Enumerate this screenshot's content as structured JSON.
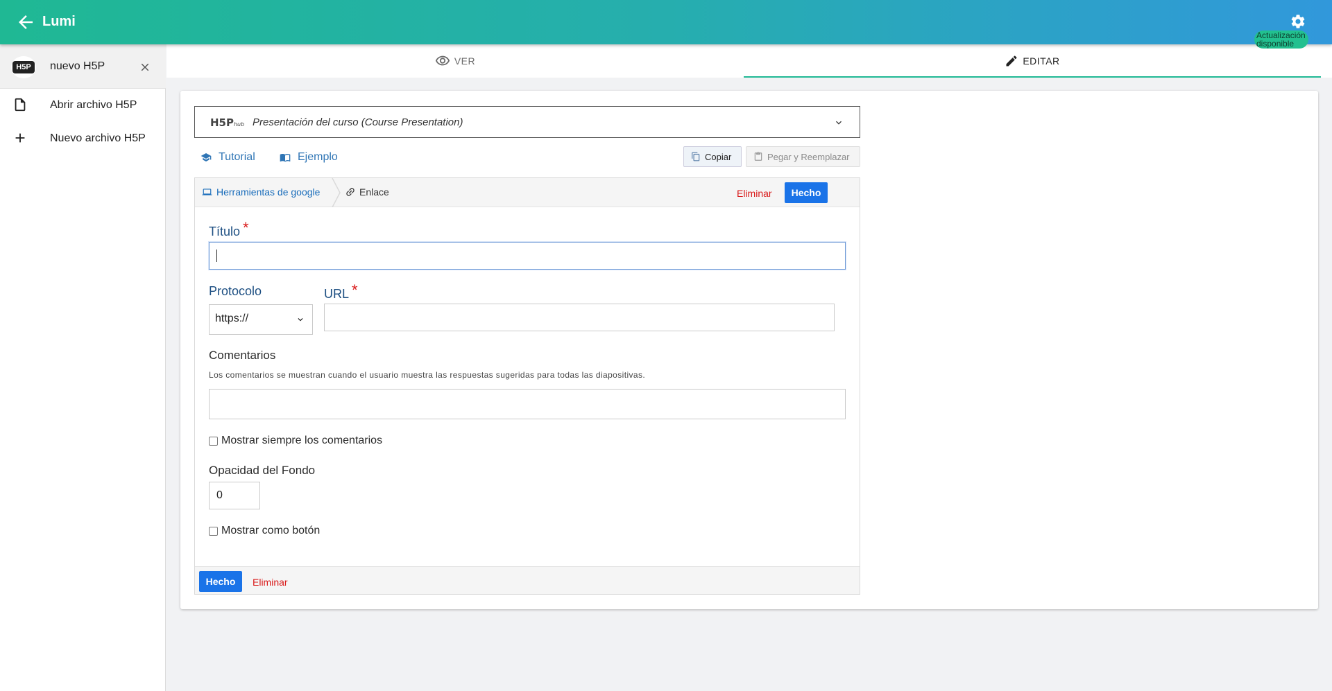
{
  "app": {
    "title": "Lumi",
    "update_badge": "Actualización disponible"
  },
  "sidebar": {
    "file_tab": {
      "logo": "H5P",
      "name": "nuevo H5P"
    },
    "items": [
      {
        "label": "Abrir archivo H5P",
        "icon": "file-icon"
      },
      {
        "label": "Nuevo archivo H5P",
        "icon": "plus-icon"
      }
    ]
  },
  "tabs": {
    "ver": "VER",
    "editar": "EDITAR"
  },
  "hub": {
    "logo": "H5P",
    "logo_sub": "hub",
    "title": "Presentación del curso (Course Presentation)"
  },
  "toolbar": {
    "tutorial": "Tutorial",
    "ejemplo": "Ejemplo",
    "copiar": "Copiar",
    "pegar": "Pegar y Reemplazar"
  },
  "editor": {
    "breadcrumb": {
      "parent": "Herramientas de google",
      "current": "Enlace"
    },
    "delete_label": "Eliminar",
    "done_label": "Hecho",
    "fields": {
      "titulo": {
        "label": "Título",
        "required": "*",
        "value": ""
      },
      "protocolo": {
        "label": "Protocolo",
        "selected": "https://"
      },
      "url": {
        "label": "URL",
        "required": "*",
        "value": ""
      },
      "comentarios": {
        "label": "Comentarios",
        "description": "Los comentarios se muestran cuando el usuario muestra las respuestas sugeridas para todas las diapositivas.",
        "value": ""
      },
      "mostrar_comentarios": {
        "label": "Mostrar siempre los comentarios",
        "checked": false
      },
      "opacidad": {
        "label": "Opacidad del Fondo",
        "value": "0"
      },
      "mostrar_boton": {
        "label": "Mostrar como botón",
        "checked": false
      }
    }
  },
  "colors": {
    "accent": "#1fb894",
    "primary_button": "#1a73e8",
    "danger": "#d91919",
    "link": "#2f75b5"
  }
}
